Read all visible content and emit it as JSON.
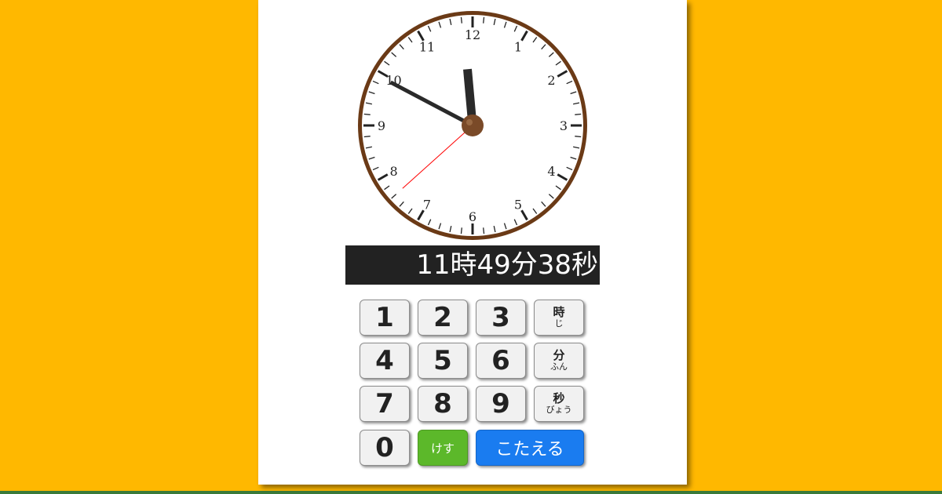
{
  "clock": {
    "numbers": [
      "12",
      "1",
      "2",
      "3",
      "4",
      "5",
      "6",
      "7",
      "8",
      "9",
      "10",
      "11"
    ],
    "time": {
      "hour": 11,
      "minute": 49,
      "second": 38
    },
    "colors": {
      "rim": "#6B3A16",
      "face": "#ffffff",
      "hands": "#2a2a2a",
      "second_hand": "#ff0000",
      "pin": "#7a4a28"
    }
  },
  "display": {
    "text": "11時49分38秒"
  },
  "keypad": {
    "digits": [
      "1",
      "2",
      "3",
      "4",
      "5",
      "6",
      "7",
      "8",
      "9",
      "0"
    ],
    "hour_key": {
      "label": "時",
      "ruby": "じ"
    },
    "minute_key": {
      "label": "分",
      "ruby": "ふん"
    },
    "second_key": {
      "label": "秒",
      "ruby": "びょう"
    },
    "clear_label": "けす",
    "answer_label": "こたえる"
  },
  "colors": {
    "background": "#FFB800",
    "clear_button": "#5cb82a",
    "answer_button": "#1a7cf0"
  }
}
